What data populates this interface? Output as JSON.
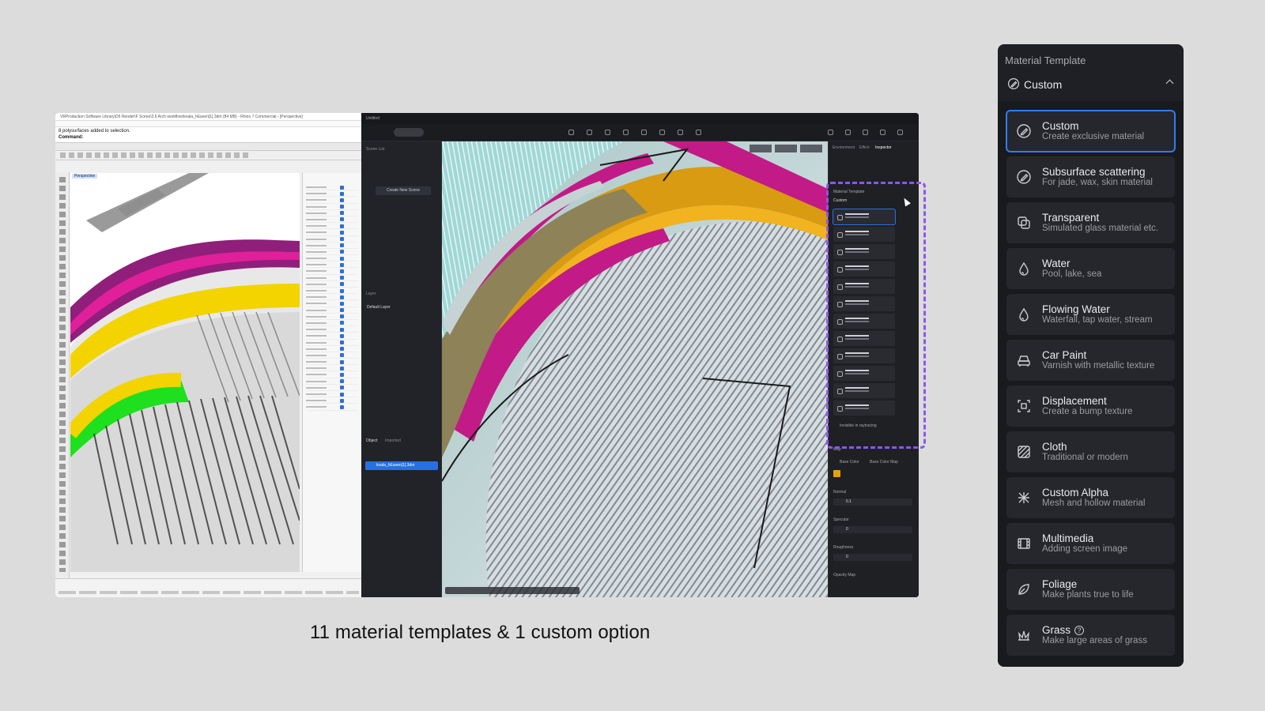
{
  "caption": "11 material templates & 1 custom option",
  "rhino": {
    "window_title": "VRProduction Software Library\\D5 Render\\F Scene\\2.6 Arch workflow\\koala_hEaven[1].3dm (84 MB) - Rhino 7 Commercial - [Perspective]",
    "command_msg": "8 polysurfaces added to selection.",
    "command_label": "Command:",
    "viewport_label": "Perspective"
  },
  "d5": {
    "window_title": "Untitled",
    "assets_label": "Assets",
    "scene_list_label": "Scene List",
    "create_scene_label": "Create New Scene",
    "layer_label": "Layer",
    "default_layer_label": "Default Layer",
    "object_tab": "Object",
    "imported_tab": "Imported",
    "object_item": "koala_hEaven[1].3dm",
    "inspector_tabs": [
      "Environment",
      "Effect",
      "Inspector"
    ],
    "material_template_label": "Material Template",
    "custom_label": "Custom",
    "invisible_label": "Invisible in raytracing",
    "map_label": "Map",
    "base_color_label": "Base Color",
    "base_color_map_label": "Base Color Map",
    "normal_label": "Normal",
    "normal_value": "0.1",
    "specular_label": "Specular",
    "specular_value": "0",
    "roughness_label": "Roughness",
    "roughness_value": "0",
    "opacity_map_label": "Opacity Map",
    "base_color_hex": "#e6a00f"
  },
  "panel": {
    "title": "Material Template",
    "selected": "Custom",
    "items": [
      {
        "name": "Custom",
        "desc": "Create exclusive material",
        "icon": "pen-icon",
        "selected": true
      },
      {
        "name": "Subsurface scattering",
        "desc": "For jade, wax, skin material",
        "icon": "pen-icon"
      },
      {
        "name": "Transparent",
        "desc": "Simulated glass material etc.",
        "icon": "layers-icon"
      },
      {
        "name": "Water",
        "desc": "Pool, lake, sea",
        "icon": "droplet-icon"
      },
      {
        "name": "Flowing Water",
        "desc": "Waterfall, tap water, stream",
        "icon": "droplet-icon"
      },
      {
        "name": "Car Paint",
        "desc": "Varnish with metallic texture",
        "icon": "car-icon"
      },
      {
        "name": "Displacement",
        "desc": "Create a bump texture",
        "icon": "displacement-icon"
      },
      {
        "name": "Cloth",
        "desc": "Traditional or modern",
        "icon": "cloth-icon"
      },
      {
        "name": "Custom Alpha",
        "desc": "Mesh and hollow material",
        "icon": "alpha-icon"
      },
      {
        "name": "Multimedia",
        "desc": "Adding screen image",
        "icon": "film-icon"
      },
      {
        "name": "Foliage",
        "desc": "Make plants true to life",
        "icon": "leaf-icon"
      },
      {
        "name": "Grass",
        "desc": "Make large areas of grass",
        "icon": "grass-icon",
        "help": "?"
      }
    ]
  },
  "colors": {
    "accent": "#2f7cf6",
    "dash_highlight": "#8d55ee",
    "panel_bg": "#1e2025"
  }
}
